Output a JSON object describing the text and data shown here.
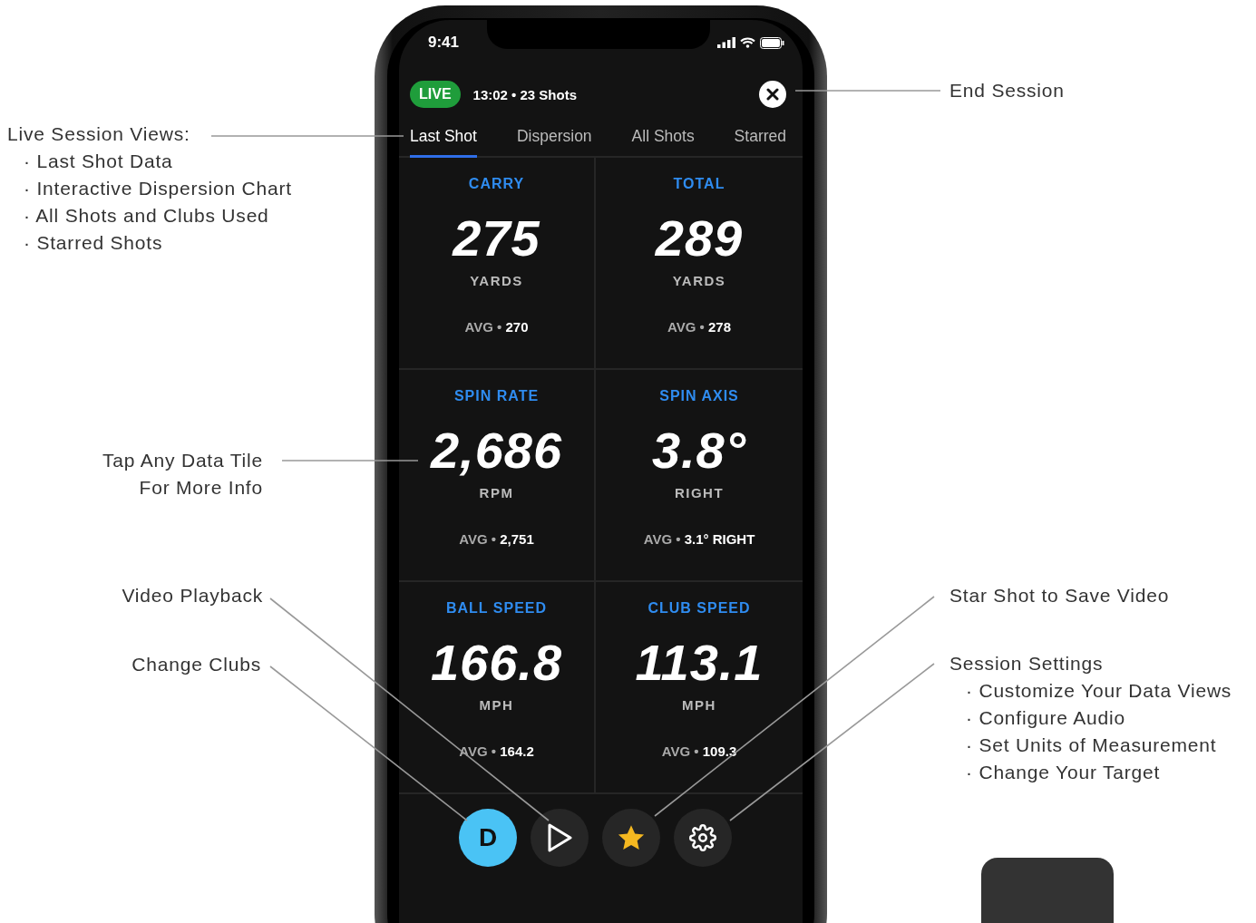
{
  "status_bar": {
    "time": "9:41"
  },
  "session": {
    "live_badge": "LIVE",
    "summary": "13:02 • 23 Shots"
  },
  "tabs": [
    {
      "label": "Last Shot",
      "selected": true
    },
    {
      "label": "Dispersion",
      "selected": false
    },
    {
      "label": "All Shots",
      "selected": false
    },
    {
      "label": "Starred",
      "selected": false
    }
  ],
  "tiles": [
    {
      "label": "CARRY",
      "value": "275",
      "unit": "YARDS",
      "avg_label": "AVG •",
      "avg_value": "270"
    },
    {
      "label": "TOTAL",
      "value": "289",
      "unit": "YARDS",
      "avg_label": "AVG •",
      "avg_value": "278"
    },
    {
      "label": "SPIN RATE",
      "value": "2,686",
      "unit": "RPM",
      "avg_label": "AVG •",
      "avg_value": "2,751"
    },
    {
      "label": "SPIN AXIS",
      "value": "3.8°",
      "unit": "RIGHT",
      "avg_label": "AVG •",
      "avg_value": "3.1° RIGHT"
    },
    {
      "label": "BALL SPEED",
      "value": "166.8",
      "unit": "MPH",
      "avg_label": "AVG •",
      "avg_value": "164.2"
    },
    {
      "label": "CLUB SPEED",
      "value": "113.1",
      "unit": "MPH",
      "avg_label": "AVG •",
      "avg_value": "109.3"
    }
  ],
  "action_buttons": [
    {
      "kind": "club",
      "label": "D"
    },
    {
      "kind": "play"
    },
    {
      "kind": "star"
    },
    {
      "kind": "settings"
    }
  ],
  "left_callouts": [
    {
      "title": "Live Session Views:",
      "bullets": [
        "· Last Shot Data",
        "· Interactive Dispersion Chart",
        "· All Shots and Clubs Used",
        "· Starred Shots"
      ]
    },
    {
      "title": "Tap Any Data Tile For More Info"
    },
    {
      "title": "Video Playback"
    },
    {
      "title": "Change Clubs"
    }
  ],
  "right_callouts": [
    {
      "title": "End Session"
    },
    {
      "title": "Star Shot to Save Video"
    },
    {
      "title": "Session Settings",
      "bullets": [
        "· Customize Your Data Views",
        "· Configure Audio",
        "· Set Units of Measurement",
        "· Change Your Target"
      ]
    }
  ]
}
